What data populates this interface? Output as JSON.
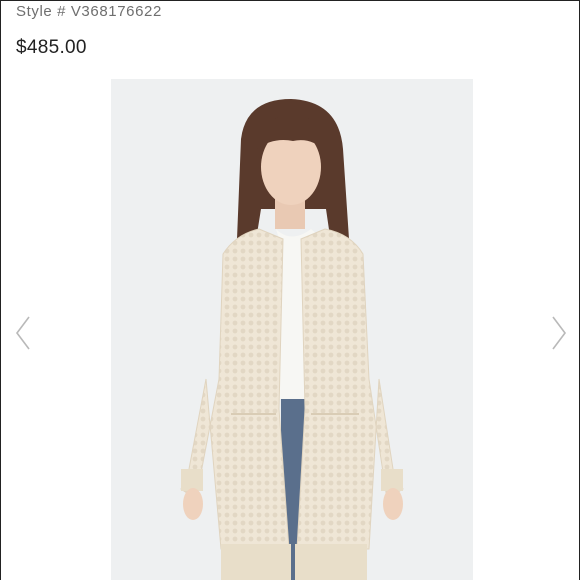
{
  "product": {
    "style_label": "Style # V368176622",
    "price": "$485.00"
  },
  "gallery": {
    "prev_icon": "chevron-left-icon",
    "next_icon": "chevron-right-icon",
    "image_subject": "model-wearing-cream-cardigan"
  },
  "colors": {
    "text_muted": "#6f6f6f",
    "text_price": "#222222",
    "arrow": "#b9b9b9",
    "image_bg": "#eef0f1",
    "cardigan": "#efe6d6",
    "hair": "#5a3a2c",
    "denim": "#5a6f8c"
  }
}
